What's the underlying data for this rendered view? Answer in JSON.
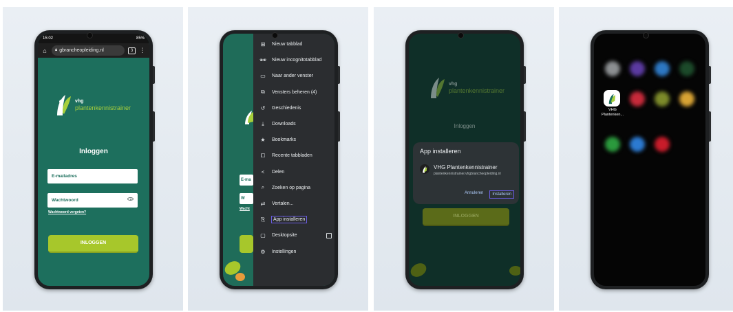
{
  "colors": {
    "brand_green": "#1d6f5d",
    "lime": "#a7c72b",
    "highlight": "#6a5de0"
  },
  "screen1": {
    "status_time": "15:02",
    "status_right": "85%",
    "url": "gbrancheopleiding.nl",
    "brand_small": "vhg",
    "brand_name": "plantenkennistrainer",
    "title": "Inloggen",
    "email_placeholder": "E-mailadres",
    "password_placeholder": "Wachtwoord",
    "forgot_link": "Wachtwoord vergeten?",
    "login_button": "INLOGGEN"
  },
  "screen2": {
    "fragment_email": "E-ma",
    "fragment_w": "W",
    "fragment_link": "Wacht",
    "menu": [
      {
        "label": "Nieuw tabblad",
        "icon": "plus-square-icon"
      },
      {
        "label": "Nieuw incognitotabblad",
        "icon": "incognito-icon"
      },
      {
        "label": "Naar ander venster",
        "icon": "window-icon"
      },
      {
        "label": "Vensters beheren (4)",
        "icon": "windows-icon"
      },
      {
        "label": "Geschiedenis",
        "icon": "history-icon"
      },
      {
        "label": "Downloads",
        "icon": "download-icon"
      },
      {
        "label": "Bookmarks",
        "icon": "star-icon"
      },
      {
        "label": "Recente tabbladen",
        "icon": "recent-tabs-icon"
      },
      {
        "label": "Delen",
        "icon": "share-icon"
      },
      {
        "label": "Zoeken op pagina",
        "icon": "find-in-page-icon"
      },
      {
        "label": "Vertalen...",
        "icon": "translate-icon"
      },
      {
        "label": "App installeren",
        "icon": "install-app-icon"
      },
      {
        "label": "Desktopsite",
        "icon": "desktop-icon"
      },
      {
        "label": "Instellingen",
        "icon": "settings-icon"
      }
    ]
  },
  "screen3": {
    "bg_title": "Inloggen",
    "bg_button": "INLOGGEN",
    "brand_small": "vhg",
    "brand_name": "plantenkennistrainer",
    "dialog_title": "App installeren",
    "app_name": "VHG Plantenkennistrainer",
    "app_url": "plantenkennistrainer.vhgbrancheopleiding.nl",
    "cancel": "Annuleren",
    "install": "Installeren"
  },
  "screen4": {
    "app_label_line1": "VHG",
    "app_label_line2": "Plantenken..."
  }
}
